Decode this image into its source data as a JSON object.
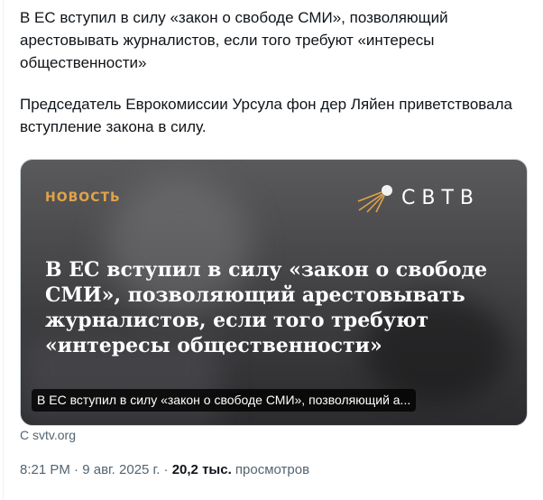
{
  "tweet": {
    "paragraph_1": "В ЕС вступил в силу «закон о свободе СМИ», позволяющий арестовывать журналистов, если того требуют «интересы общественности»",
    "paragraph_2": "Председатель Еврокомиссии Урсула фон дер Ляйен приветствовала вступление закона в силу."
  },
  "card": {
    "label": "НОВОСТЬ",
    "logo_text": "СВТВ",
    "headline": "В ЕС вступил в силу «закон о свободе СМИ», позволяющий арестовывать журналистов, если того требуют «интересы общественности»",
    "caption": "В ЕС вступил в силу «закон о свободе СМИ», позволяющий а...",
    "label_color": "#e0a34a"
  },
  "source": "С svtv.org",
  "meta": {
    "time": "8:21 PM",
    "sep1": " · ",
    "date": "9 авг. 2025 г.",
    "sep2": " · ",
    "views_count": "20,2 тыс.",
    "views_label": " просмотров"
  },
  "icons": [
    "satellite-logo-icon"
  ]
}
